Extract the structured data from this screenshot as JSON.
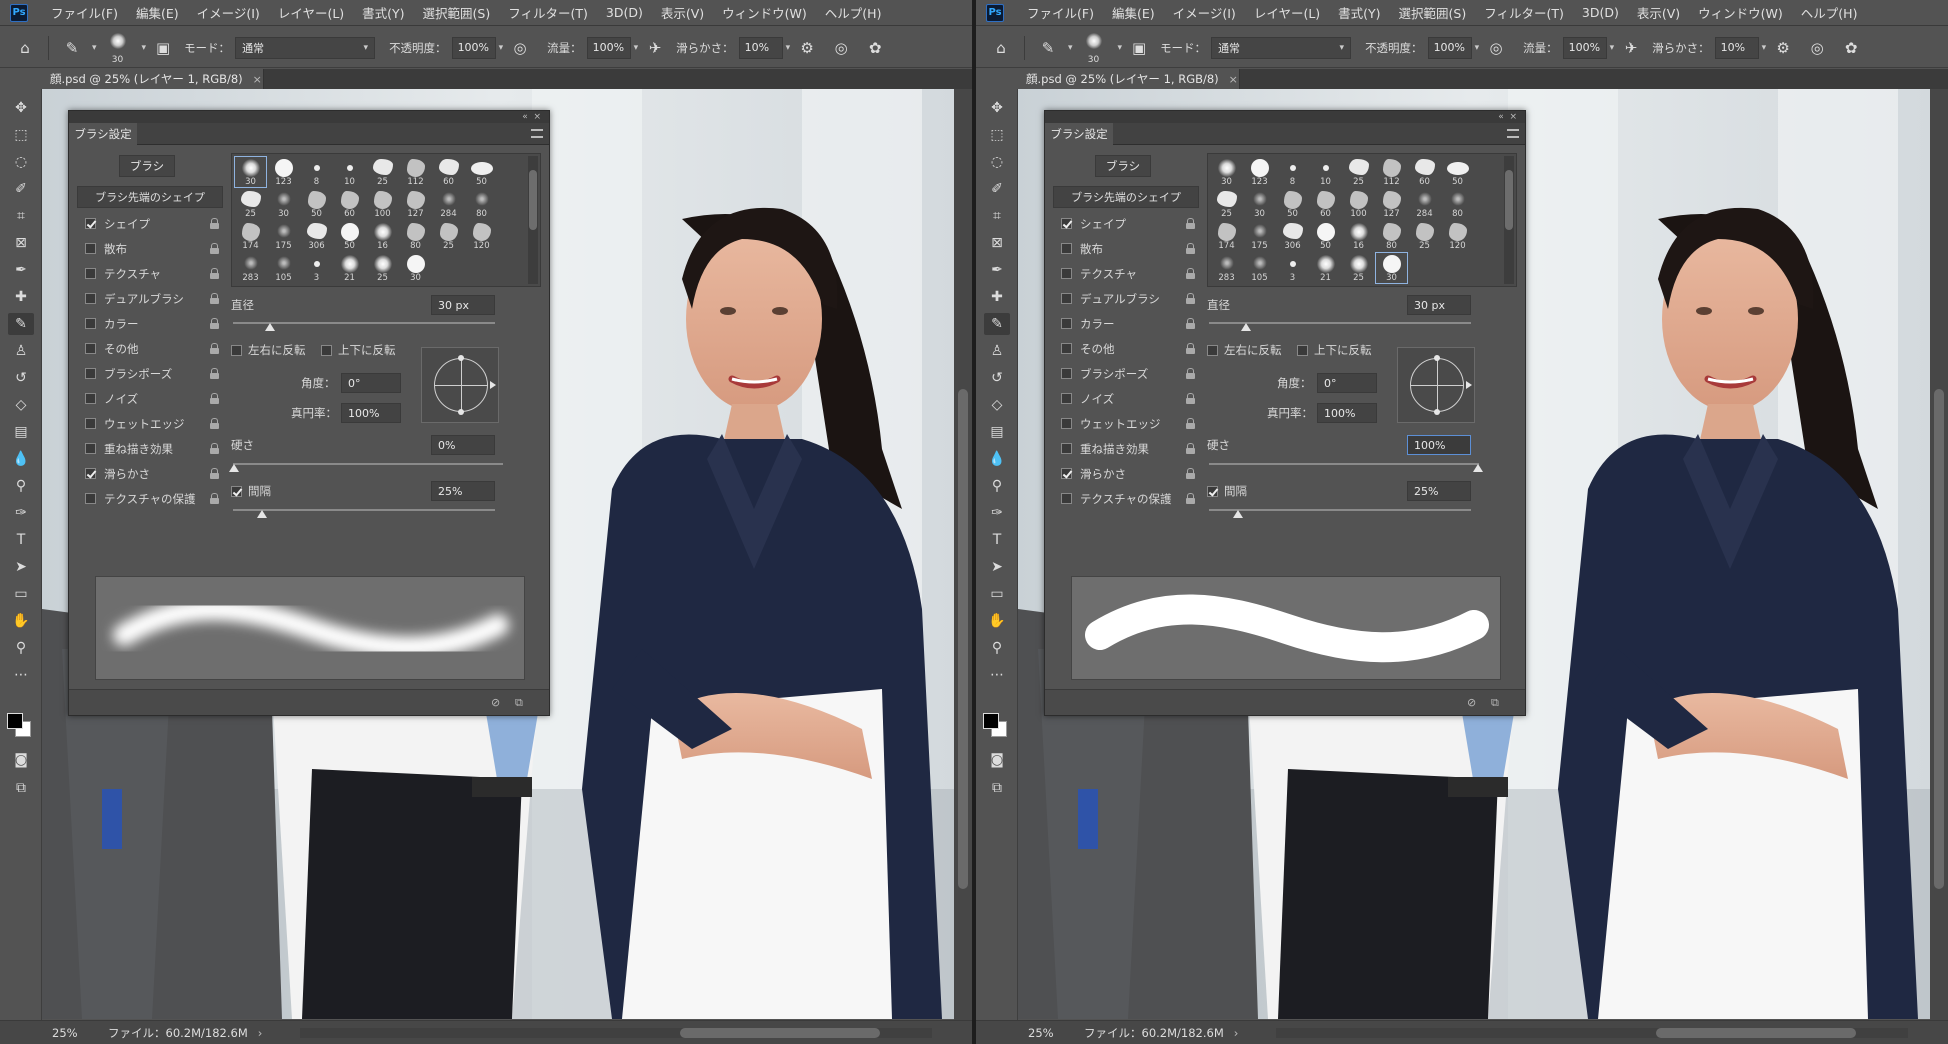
{
  "app": {
    "logo": "Ps",
    "menus": [
      "ファイル(F)",
      "編集(E)",
      "イメージ(I)",
      "レイヤー(L)",
      "書式(Y)",
      "選択範囲(S)",
      "フィルター(T)",
      "3D(D)",
      "表示(V)",
      "ウィンドウ(W)",
      "ヘルプ(H)"
    ]
  },
  "options_bar": {
    "brush_size": "30",
    "mode_label": "モード：",
    "mode_value": "通常",
    "opacity_label": "不透明度：",
    "opacity_value": "100%",
    "flow_label": "流量：",
    "flow_value": "100%",
    "smoothing_label": "滑らかさ：",
    "smoothing_value": "10%"
  },
  "document": {
    "tab_title": "顔.psd @ 25% (レイヤー 1, RGB/8)",
    "zoom": "25%",
    "file_info": "ファイル：60.2M/182.6M"
  },
  "brush_panel": {
    "tab_label": "ブラシ設定",
    "brush_button": "ブラシ",
    "category_header": "ブラシ先端のシェイプ",
    "categories": [
      {
        "label": "シェイプ",
        "checked": true
      },
      {
        "label": "散布",
        "checked": false
      },
      {
        "label": "テクスチャ",
        "checked": false
      },
      {
        "label": "デュアルブラシ",
        "checked": false
      },
      {
        "label": "カラー",
        "checked": false
      },
      {
        "label": "その他",
        "checked": false
      },
      {
        "label": "ブラシポーズ",
        "checked": false
      },
      {
        "label": "ノイズ",
        "checked": false
      },
      {
        "label": "ウェットエッジ",
        "checked": false
      },
      {
        "label": "重ね描き効果",
        "checked": false
      },
      {
        "label": "滑らかさ",
        "checked": true
      },
      {
        "label": "テクスチャの保護",
        "checked": false
      }
    ],
    "presets": [
      {
        "size": "30",
        "kind": "soft"
      },
      {
        "size": "123",
        "kind": "hard"
      },
      {
        "size": "8",
        "kind": "tiny"
      },
      {
        "size": "10",
        "kind": "tiny"
      },
      {
        "size": "25",
        "kind": "splat"
      },
      {
        "size": "112",
        "kind": "rough"
      },
      {
        "size": "60",
        "kind": "splat"
      },
      {
        "size": "50",
        "kind": "flat"
      },
      {
        "size": "25",
        "kind": "splat"
      },
      {
        "size": "30",
        "kind": "speck"
      },
      {
        "size": "50",
        "kind": "rough"
      },
      {
        "size": "60",
        "kind": "rough"
      },
      {
        "size": "100",
        "kind": "rough"
      },
      {
        "size": "127",
        "kind": "rough"
      },
      {
        "size": "284",
        "kind": "speck"
      },
      {
        "size": "80",
        "kind": "speck"
      },
      {
        "size": "174",
        "kind": "rough"
      },
      {
        "size": "175",
        "kind": "speck"
      },
      {
        "size": "306",
        "kind": "splat"
      },
      {
        "size": "50",
        "kind": "hard"
      },
      {
        "size": "16",
        "kind": "soft"
      },
      {
        "size": "80",
        "kind": "rough"
      },
      {
        "size": "25",
        "kind": "rough"
      },
      {
        "size": "120",
        "kind": "rough"
      },
      {
        "size": "283",
        "kind": "speck"
      },
      {
        "size": "105",
        "kind": "speck"
      },
      {
        "size": "3",
        "kind": "tiny"
      },
      {
        "size": "21",
        "kind": "soft"
      },
      {
        "size": "25",
        "kind": "soft"
      },
      {
        "size": "30",
        "kind": "hard"
      }
    ],
    "diameter_label": "直径",
    "diameter_value": "30 px",
    "flip_x_label": "左右に反転",
    "flip_y_label": "上下に反転",
    "angle_label": "角度：",
    "angle_value": "0°",
    "roundness_label": "真円率：",
    "roundness_value": "100%",
    "hardness_label": "硬さ",
    "spacing_label": "間隔",
    "spacing_value": "25%"
  },
  "panes": [
    {
      "side": "left",
      "hardness_value": "0%",
      "hardness_level": 0.0,
      "selected_preset": 0,
      "preview_stroke": "soft"
    },
    {
      "side": "right",
      "hardness_value": "100%",
      "hardness_level": 1.0,
      "selected_preset": 29,
      "preview_stroke": "hard"
    }
  ]
}
